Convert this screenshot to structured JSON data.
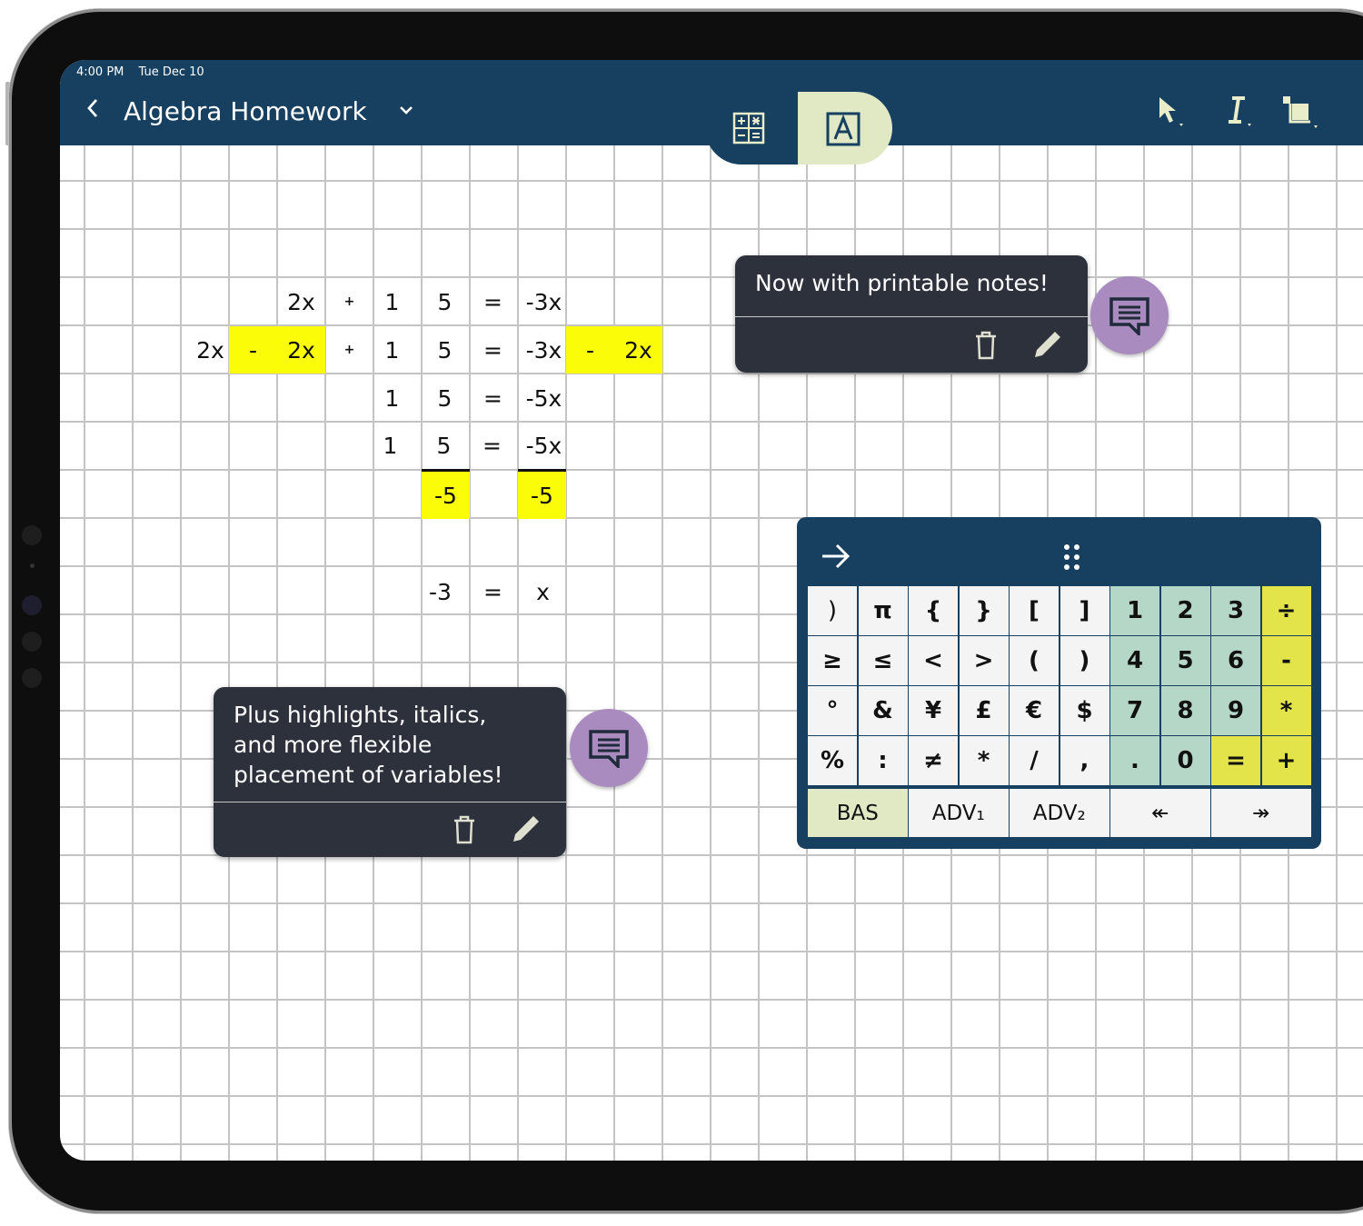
{
  "status": {
    "time": "4:00 PM",
    "date": "Tue Dec 10"
  },
  "header": {
    "title": "Algebra Homework"
  },
  "colors": {
    "bar": "#163f60",
    "highlight": "#fbfc07",
    "note": "#2c313c",
    "bubble": "#a98bc0",
    "tab_active": "#e0e8c4"
  },
  "icons": [
    "back-chevron-icon",
    "title-dropdown-icon",
    "calculator-icon",
    "text-box-icon",
    "pointer-tool-icon",
    "italic-tool-icon",
    "crop-tool-icon",
    "comment-icon",
    "trash-icon",
    "pencil-icon",
    "arrow-right-icon",
    "drag-handle-icon"
  ],
  "math": {
    "row1": [
      "2x",
      "+",
      "1",
      "5",
      "=",
      "-3x"
    ],
    "row2": [
      "2x",
      "-",
      "2x",
      "+",
      "1",
      "5",
      "=",
      "-3x",
      "-",
      "2x"
    ],
    "row3": [
      "1",
      "5",
      "=",
      "-5x"
    ],
    "row4": [
      "1",
      "5",
      "=",
      "-5x"
    ],
    "row5": [
      "-5",
      "-5"
    ],
    "row6": [
      "-3",
      "=",
      "x"
    ]
  },
  "notes": [
    {
      "text": "Now with printable notes!"
    },
    {
      "text": "Plus highlights, italics, and more flexible placement of variables!"
    }
  ],
  "keyboard": {
    "keys": [
      [
        ")",
        "π",
        "{",
        "}",
        "[",
        "]",
        "1",
        "2",
        "3",
        "÷"
      ],
      [
        "≥",
        "≤",
        "<",
        ">",
        "(",
        ")",
        "4",
        "5",
        "6",
        "-"
      ],
      [
        "°",
        "&",
        "¥",
        "£",
        "€",
        "$",
        "7",
        "8",
        "9",
        "*"
      ],
      [
        "%",
        ":",
        "≠",
        "*",
        "/",
        ",",
        ".",
        "0",
        "=",
        "+"
      ]
    ],
    "modes": [
      "BAS",
      "ADV₁",
      "ADV₂",
      "↞",
      "↠"
    ]
  }
}
